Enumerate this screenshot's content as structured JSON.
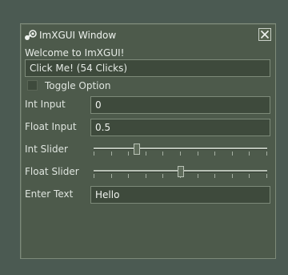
{
  "window": {
    "title": "ImXGUI Window",
    "welcome": "Welcome to ImXGUI!",
    "button_label": "Click Me! (54 Clicks)",
    "checkbox": {
      "label": "Toggle Option",
      "checked": false
    },
    "int_input": {
      "label": "Int Input",
      "value": "0"
    },
    "float_input": {
      "label": "Float Input",
      "value": "0.5"
    },
    "int_slider": {
      "label": "Int Slider",
      "fraction": 0.25,
      "ticks": 11
    },
    "float_slider": {
      "label": "Float Slider",
      "fraction": 0.5,
      "ticks": 11
    },
    "text_input": {
      "label": "Enter Text",
      "value": "Hello"
    },
    "icons": {
      "title": "steam-icon",
      "close": "close-icon"
    }
  }
}
